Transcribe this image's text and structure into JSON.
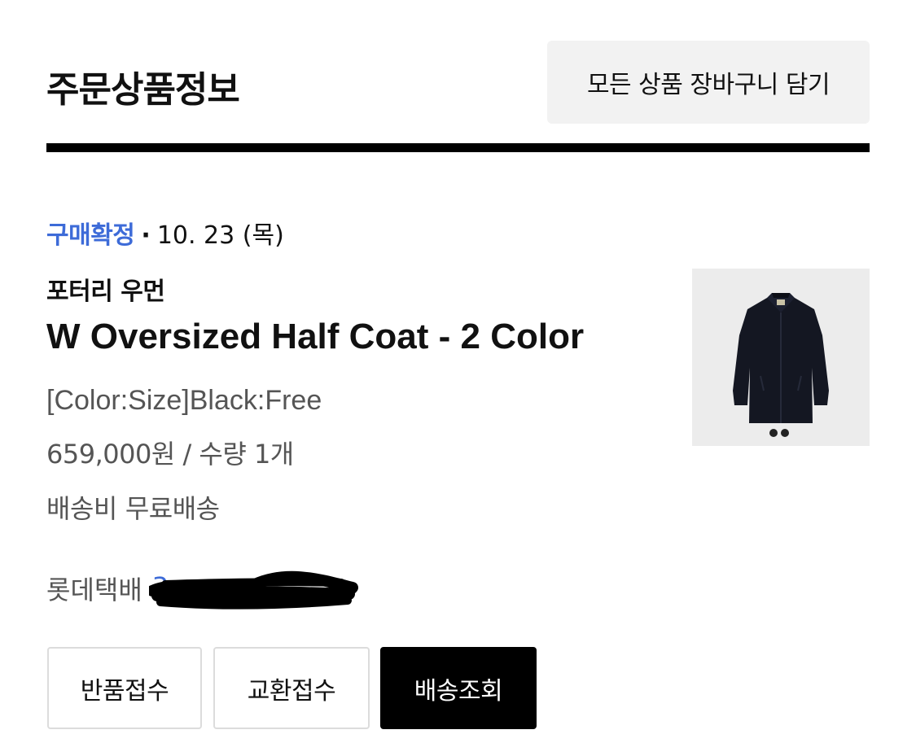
{
  "header": {
    "title": "주문상품정보",
    "cart_all_label": "모든 상품 장바구니 담기"
  },
  "order": {
    "status": "구매확정",
    "separator": "·",
    "date": "10. 23 (목)",
    "brand": "포터리 우먼",
    "product_name": "W Oversized Half Coat - 2 Color",
    "option": "[Color:Size]Black:Free",
    "price_qty": "659,000원 / 수량 1개",
    "shipping_label": "배송비",
    "shipping_value": "무료배송",
    "courier": "롯데택배",
    "tracking_visible_prefix": "3",
    "image_count": 2
  },
  "actions": {
    "return_label": "반품접수",
    "exchange_label": "교환접수",
    "track_label": "배송조회"
  },
  "colors": {
    "accent": "#3d6bd8",
    "primary_button_bg": "#000000",
    "secondary_button_border": "#dcdcdc",
    "muted_text": "#555555"
  }
}
